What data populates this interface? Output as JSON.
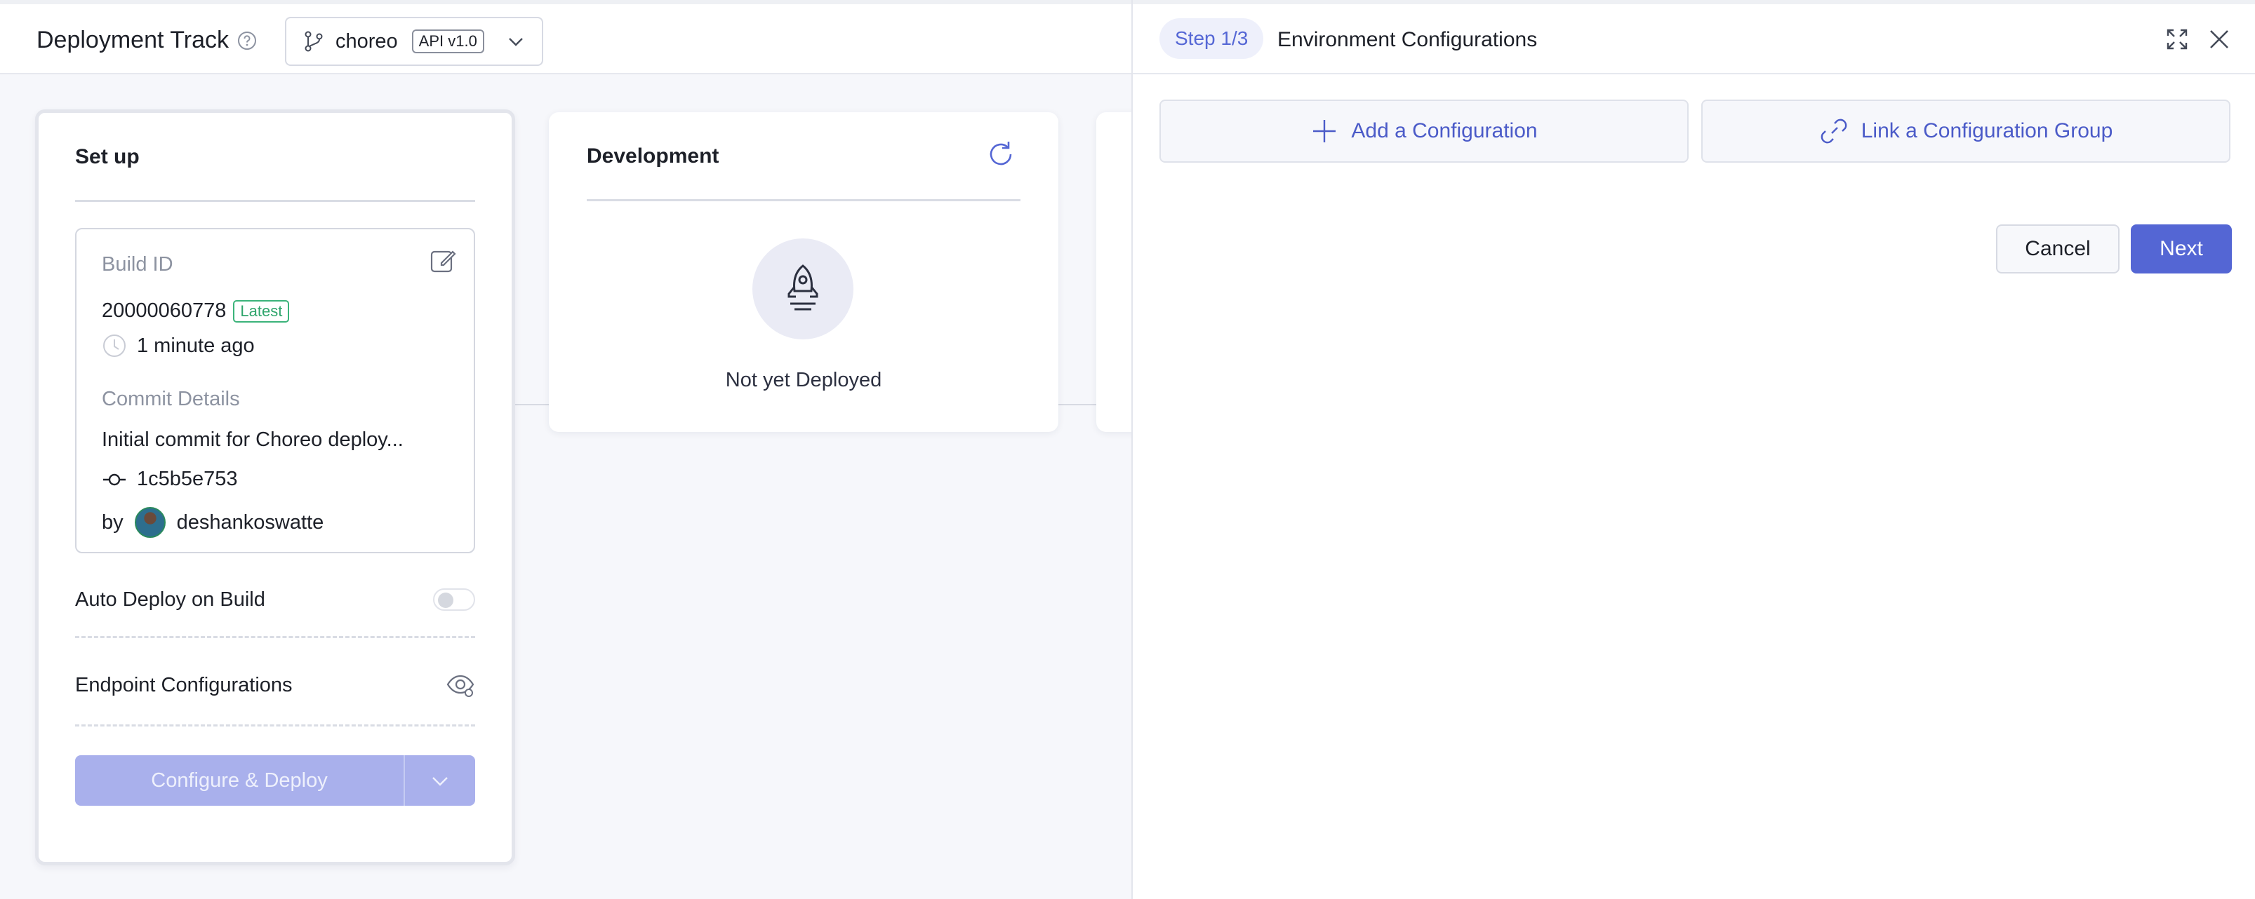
{
  "header": {
    "title": "Deployment Track",
    "branch": "choreo",
    "api_version": "API v1.0"
  },
  "setup": {
    "heading": "Set up",
    "build_label": "Build ID",
    "build_id": "20000060778",
    "latest_badge": "Latest",
    "build_time": "1 minute ago",
    "commit_label": "Commit Details",
    "commit_message": "Initial commit for Choreo deploy...",
    "commit_hash": "1c5b5e753",
    "author_prefix": "by",
    "author": "deshankoswatte",
    "auto_deploy_label": "Auto Deploy on Build",
    "auto_deploy_enabled": false,
    "endpoint_label": "Endpoint Configurations",
    "deploy_button": "Configure & Deploy"
  },
  "development": {
    "heading": "Development",
    "status": "Not yet Deployed"
  },
  "panel": {
    "step": "Step 1/3",
    "title": "Environment Configurations",
    "add_config": "Add a Configuration",
    "link_group": "Link a Configuration Group",
    "cancel": "Cancel",
    "next": "Next"
  },
  "colors": {
    "accent": "#5466d4",
    "accent_disabled": "#a9b0ec",
    "latest_green": "#2fa56c"
  },
  "icons": [
    "help-icon",
    "git-branch-icon",
    "chevron-down-icon",
    "edit-icon",
    "clock-icon",
    "commit-icon",
    "eye-settings-icon",
    "refresh-icon",
    "rocket-icon",
    "plus-icon",
    "link-icon",
    "expand-icon",
    "close-icon"
  ]
}
